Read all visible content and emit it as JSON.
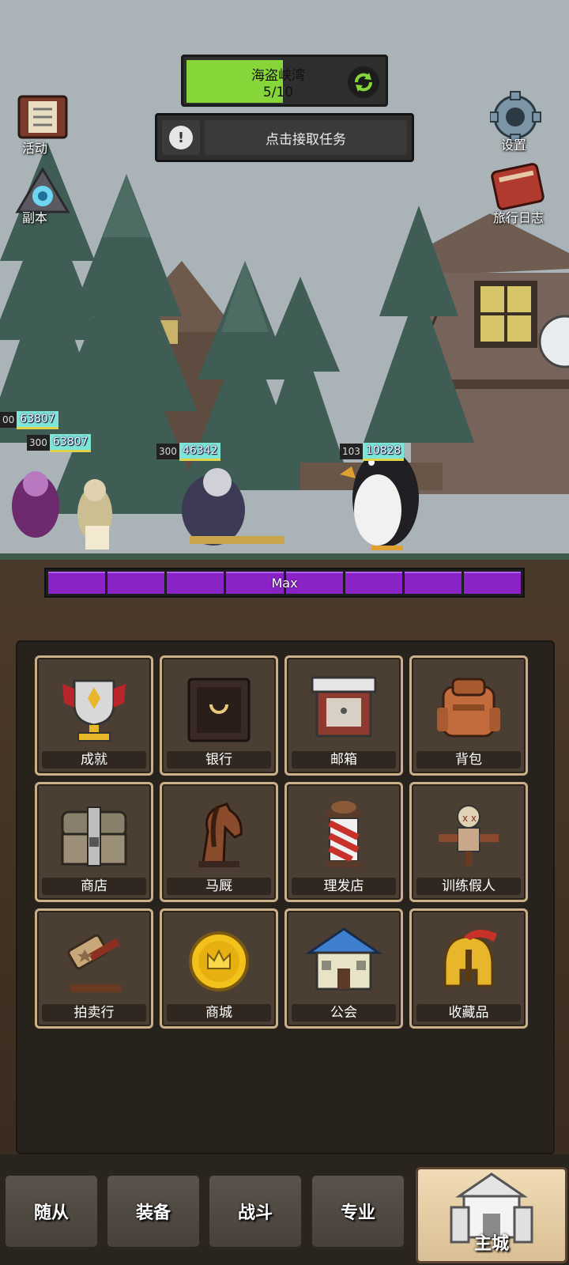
{
  "zone": {
    "name": "海盗峡湾",
    "progress_text": "5/10",
    "progress": 0.5
  },
  "task": {
    "label": "点击接取任务",
    "alert_symbol": "!"
  },
  "side_buttons": {
    "events": "活动",
    "dungeon": "副本",
    "settings": "设置",
    "travel_log": "旅行日志"
  },
  "units": [
    {
      "level": "00",
      "hp": "63807"
    },
    {
      "level": "300",
      "hp": "63807"
    },
    {
      "level": "300",
      "hp": "46342"
    },
    {
      "level": "103",
      "hp": "10828"
    }
  ],
  "rage_bar": {
    "label": "Max",
    "segments": 8
  },
  "buildings": [
    {
      "name": "成就",
      "icon": "trophy-icon"
    },
    {
      "name": "银行",
      "icon": "safe-icon"
    },
    {
      "name": "邮箱",
      "icon": "mailbox-icon"
    },
    {
      "name": "背包",
      "icon": "backpack-icon"
    },
    {
      "name": "商店",
      "icon": "chest-icon"
    },
    {
      "name": "马厩",
      "icon": "horse-icon"
    },
    {
      "name": "理发店",
      "icon": "barber-pole-icon"
    },
    {
      "name": "训练假人",
      "icon": "training-dummy-icon"
    },
    {
      "name": "拍卖行",
      "icon": "gavel-icon"
    },
    {
      "name": "商城",
      "icon": "gold-coin-icon"
    },
    {
      "name": "公会",
      "icon": "guild-house-icon"
    },
    {
      "name": "收藏品",
      "icon": "helmet-icon"
    }
  ],
  "nav": {
    "followers": "随从",
    "equipment": "装备",
    "battle": "战斗",
    "profession": "专业",
    "main_city": "主城"
  },
  "colors": {
    "progress_green": "#86d63a",
    "rage_purple": "#8a23c6",
    "hp_cyan": "#7ee6d6",
    "tile_border": "#c9b08a"
  }
}
